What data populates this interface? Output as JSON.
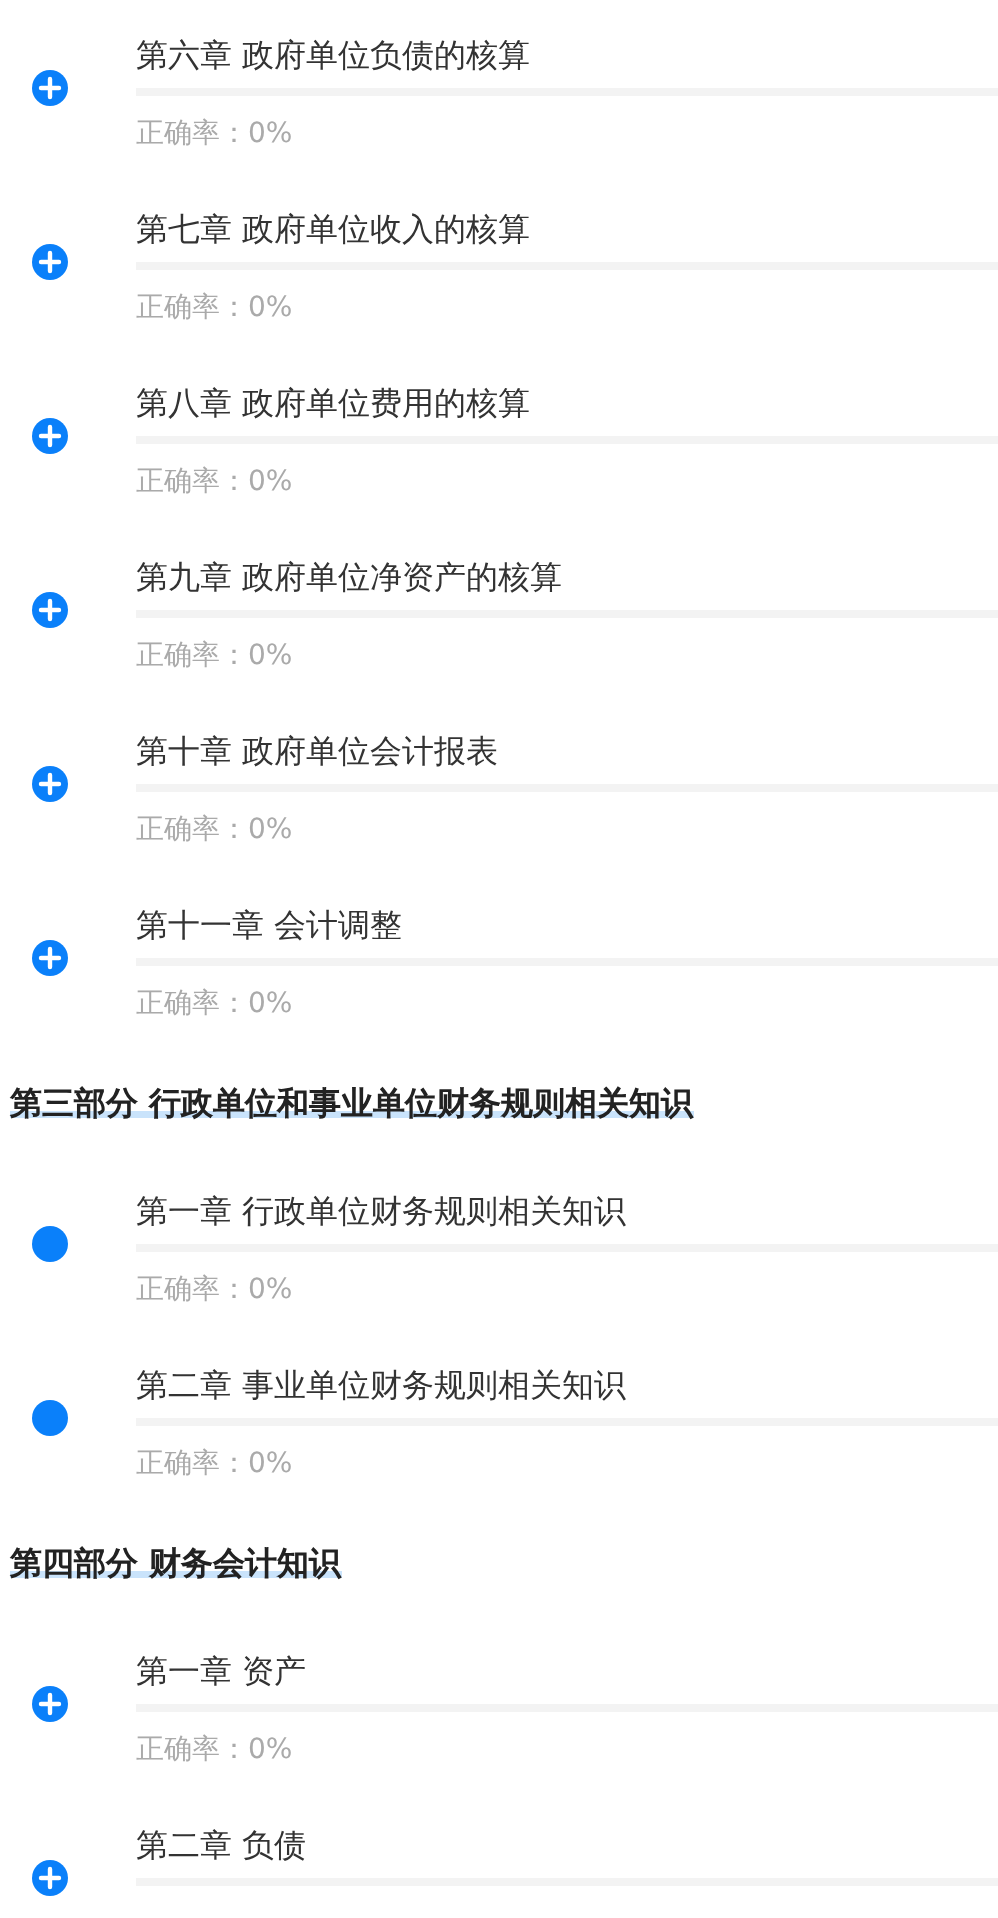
{
  "entries": [
    {
      "kind": "chapter",
      "expandable": true,
      "title": "第六章 政府单位负债的核算",
      "level": 0,
      "accuracy": "正确率：0%"
    },
    {
      "kind": "chapter",
      "expandable": true,
      "title": "第七章 政府单位收入的核算",
      "level": 0,
      "accuracy": "正确率：0%"
    },
    {
      "kind": "chapter",
      "expandable": true,
      "title": "第八章 政府单位费用的核算",
      "level": 0,
      "accuracy": "正确率：0%"
    },
    {
      "kind": "chapter",
      "expandable": true,
      "title": "第九章 政府单位净资产的核算",
      "level": 0,
      "accuracy": "正确率：0%"
    },
    {
      "kind": "chapter",
      "expandable": true,
      "title": "第十章 政府单位会计报表",
      "level": 0,
      "accuracy": "正确率：0%"
    },
    {
      "kind": "chapter",
      "expandable": true,
      "title": "第十一章 会计调整",
      "level": 0,
      "accuracy": "正确率：0%"
    },
    {
      "kind": "section",
      "title": "第三部分 行政单位和事业单位财务规则相关知识"
    },
    {
      "kind": "chapter",
      "expandable": false,
      "title": "第一章 行政单位财务规则相关知识",
      "level": 0,
      "accuracy": "正确率：0%"
    },
    {
      "kind": "chapter",
      "expandable": false,
      "title": "第二章 事业单位财务规则相关知识",
      "level": 0,
      "accuracy": "正确率：0%"
    },
    {
      "kind": "section",
      "title": "第四部分 财务会计知识"
    },
    {
      "kind": "chapter",
      "expandable": true,
      "title": "第一章 资产",
      "level": 0,
      "accuracy": "正确率：0%"
    },
    {
      "kind": "chapter",
      "expandable": true,
      "title": "第二章 负债",
      "level": 0
    }
  ]
}
